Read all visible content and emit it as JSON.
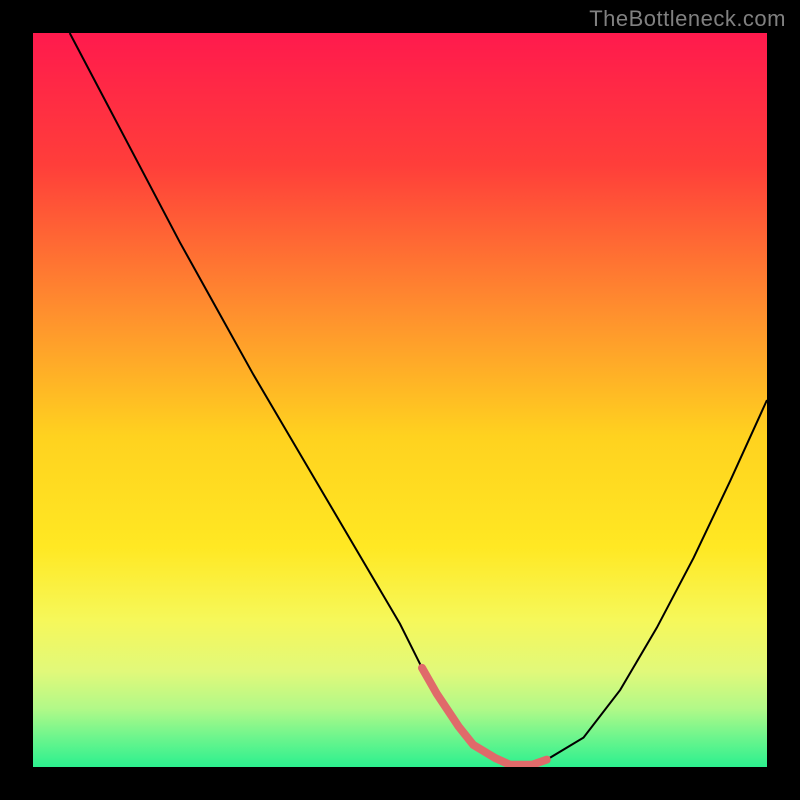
{
  "watermark": "TheBottleneck.com",
  "chart_data": {
    "type": "line",
    "title": "",
    "xlabel": "",
    "ylabel": "",
    "xlim": [
      0,
      100
    ],
    "ylim": [
      0,
      100
    ],
    "gradient_stops": [
      {
        "offset": 0,
        "color": "#ff1a4d"
      },
      {
        "offset": 18,
        "color": "#ff3e3a"
      },
      {
        "offset": 38,
        "color": "#ff8f2e"
      },
      {
        "offset": 55,
        "color": "#ffd21f"
      },
      {
        "offset": 70,
        "color": "#ffe823"
      },
      {
        "offset": 80,
        "color": "#f6f85a"
      },
      {
        "offset": 87,
        "color": "#e1f97a"
      },
      {
        "offset": 92,
        "color": "#b2f988"
      },
      {
        "offset": 96,
        "color": "#6cf58d"
      },
      {
        "offset": 100,
        "color": "#2cf08e"
      }
    ],
    "series": [
      {
        "name": "curve",
        "stroke": "#000000",
        "stroke_width": 2,
        "x": [
          5,
          10,
          15,
          20,
          25,
          30,
          35,
          40,
          45,
          50,
          53,
          55,
          58,
          60,
          63,
          65,
          68,
          70,
          75,
          80,
          85,
          90,
          95,
          100
        ],
        "y": [
          100,
          90.5,
          81,
          71.5,
          62.5,
          53.5,
          45,
          36.5,
          28,
          19.5,
          13.5,
          10,
          5.5,
          3,
          1.2,
          0.3,
          0.3,
          1,
          4,
          10.5,
          19,
          28.5,
          39,
          50
        ]
      },
      {
        "name": "highlight",
        "stroke": "#e06a6a",
        "stroke_width": 8,
        "x": [
          53,
          55,
          58,
          60,
          63,
          65,
          68,
          70
        ],
        "y": [
          13.5,
          10,
          5.5,
          3,
          1.2,
          0.3,
          0.3,
          1
        ]
      }
    ]
  }
}
